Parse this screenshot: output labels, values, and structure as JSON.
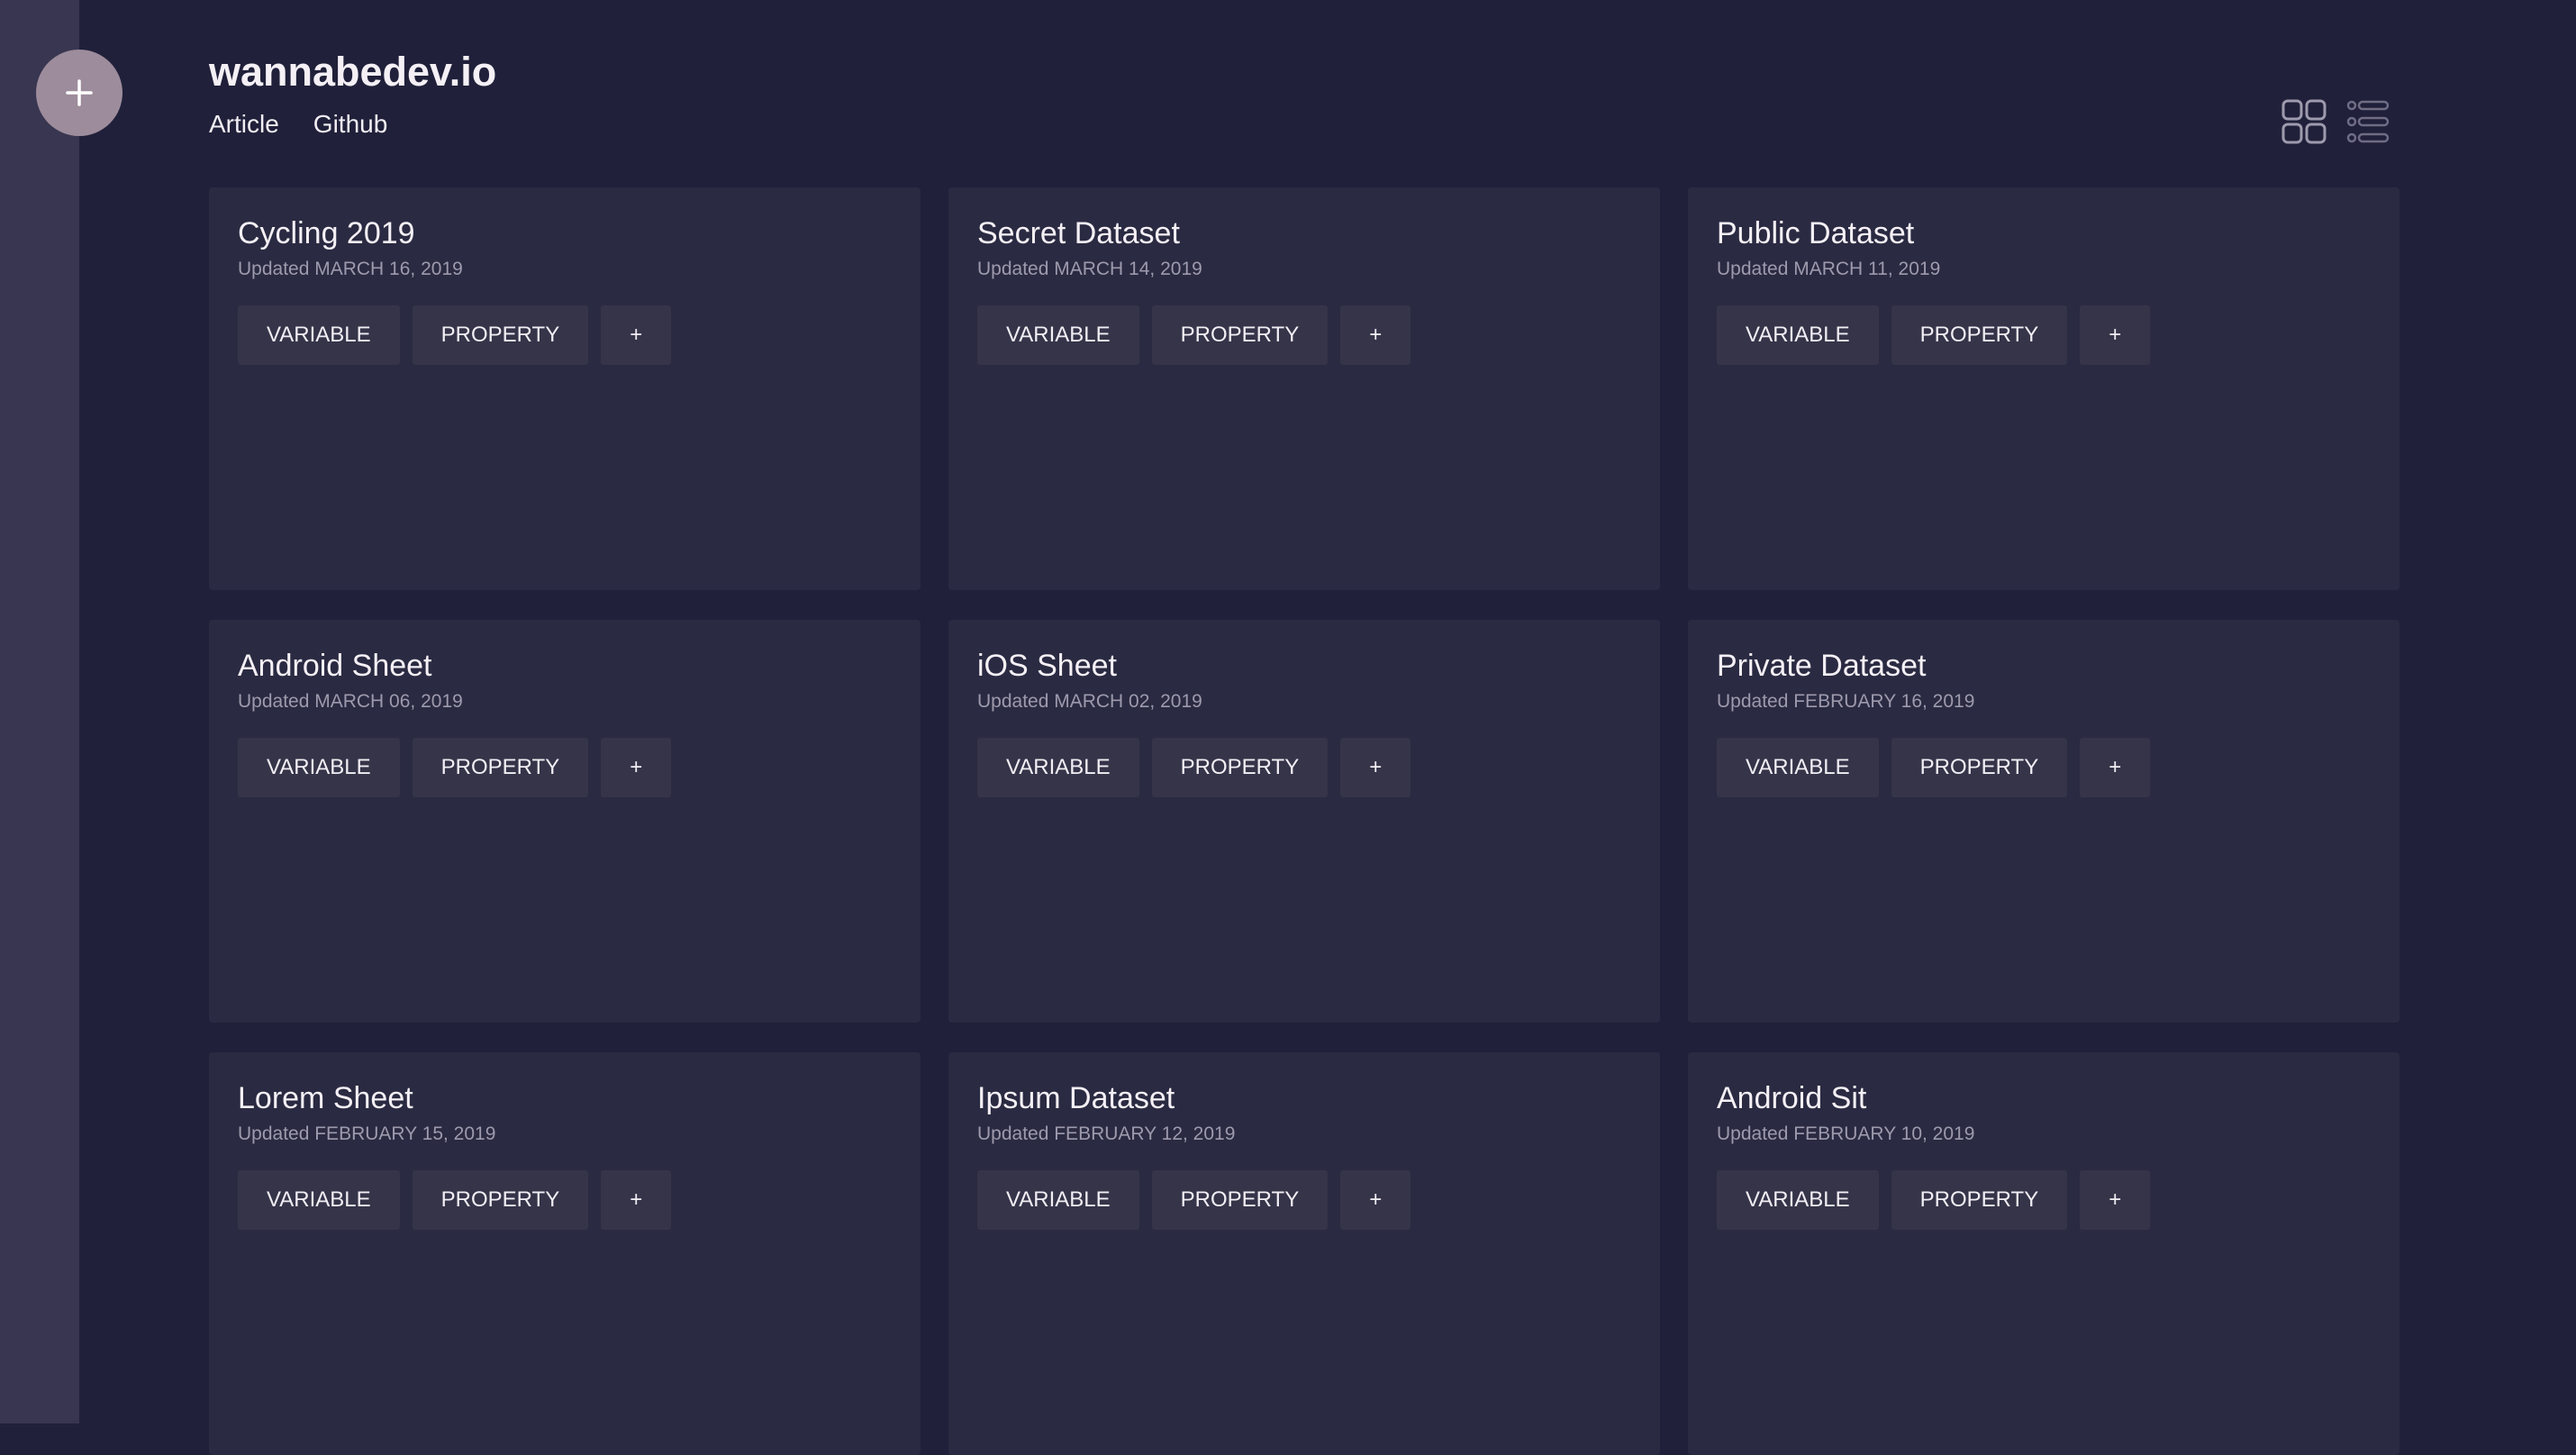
{
  "app": {
    "brand": "wannabedev.io",
    "fab_label": "+",
    "nav": [
      "Article",
      "Github"
    ]
  },
  "view_toggle": {
    "grid_icon": "grid-view-icon",
    "list_icon": "list-view-icon"
  },
  "cards": [
    {
      "title": "Cycling 2019",
      "updated": "Updated MARCH 16, 2019",
      "chips": [
        "VARIABLE",
        "PROPERTY",
        "+"
      ]
    },
    {
      "title": "Secret Dataset",
      "updated": "Updated MARCH 14, 2019",
      "chips": [
        "VARIABLE",
        "PROPERTY",
        "+"
      ]
    },
    {
      "title": "Public Dataset",
      "updated": "Updated MARCH 11, 2019",
      "chips": [
        "VARIABLE",
        "PROPERTY",
        "+"
      ]
    },
    {
      "title": "Android Sheet",
      "updated": "Updated MARCH 06, 2019",
      "chips": [
        "VARIABLE",
        "PROPERTY",
        "+"
      ]
    },
    {
      "title": "iOS Sheet",
      "updated": "Updated MARCH 02, 2019",
      "chips": [
        "VARIABLE",
        "PROPERTY",
        "+"
      ]
    },
    {
      "title": "Private Dataset",
      "updated": "Updated FEBRUARY 16, 2019",
      "chips": [
        "VARIABLE",
        "PROPERTY",
        "+"
      ]
    },
    {
      "title": "Lorem Sheet",
      "updated": "Updated FEBRUARY 15, 2019",
      "chips": [
        "VARIABLE",
        "PROPERTY",
        "+"
      ]
    },
    {
      "title": "Ipsum Dataset",
      "updated": "Updated FEBRUARY 12, 2019",
      "chips": [
        "VARIABLE",
        "PROPERTY",
        "+"
      ]
    },
    {
      "title": "Android Sit",
      "updated": "Updated FEBRUARY 10, 2019",
      "chips": [
        "VARIABLE",
        "PROPERTY",
        "+"
      ]
    }
  ],
  "colors": {
    "background": "#20203a",
    "sidebar": "#383650",
    "card": "#2a2a42",
    "chip": "#353449",
    "fab": "#9d8c9c",
    "muted_text": "#9e9aad"
  }
}
